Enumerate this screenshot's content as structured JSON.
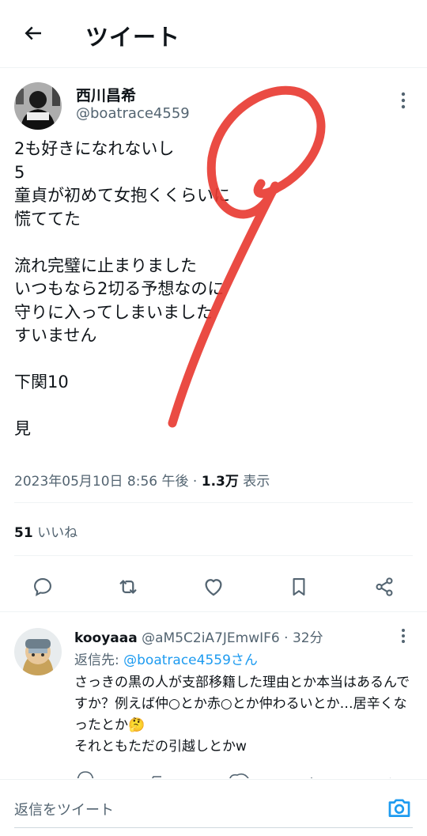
{
  "header": {
    "title": "ツイート"
  },
  "tweet": {
    "author_name": "西川昌希",
    "author_handle": "@boatrace4559",
    "body": "2も好きになれないし\n5\n童貞が初めて女抱くくらいに\n慌ててた\n\n流れ完璧に止まりました\nいつもなら2切る予想なのに\n守りに入ってしまいました\nすいません\n\n下関10\n\n見",
    "datetime": "2023年05月10日 8:56 午後",
    "views_count": "1.3万",
    "views_label": "表示",
    "likes_count": "51",
    "likes_label": "いいね"
  },
  "reply": {
    "name": "kooyaaa",
    "handle": "@aM5C2iA7JEmwIF6",
    "time": "32分",
    "reply_to_prefix": "返信先: ",
    "reply_to_handle": "@boatrace4559さん",
    "text": "さっきの黒の人が支部移籍した理由とか本当はあるんですか？例えば仲○とか赤○とか仲わるいとか…居辛くなったとか🤔\nそれともただの引越しとかw"
  },
  "compose": {
    "placeholder": "返信をツイート"
  },
  "colors": {
    "accent": "#1d9bf0",
    "annotation": "#e8372f",
    "text": "#0f1419",
    "secondary": "#536471"
  }
}
